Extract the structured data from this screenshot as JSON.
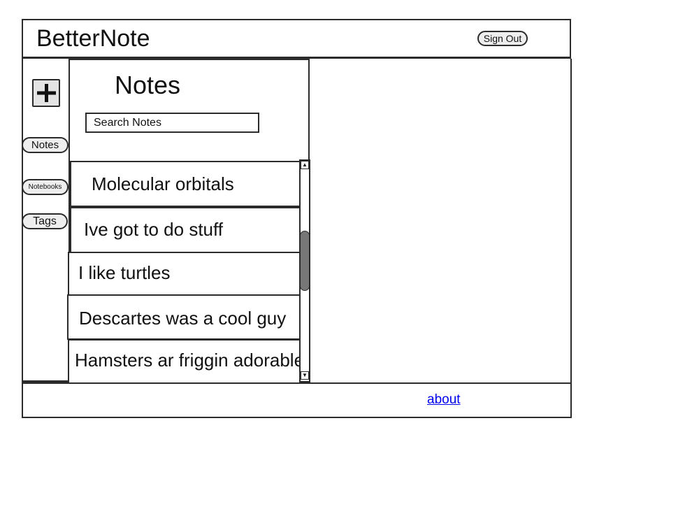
{
  "header": {
    "app_title": "BetterNote",
    "sign_out_label": "Sign Out"
  },
  "sidebar": {
    "add_icon": "plus-icon",
    "items": [
      {
        "label": "Notes"
      },
      {
        "label": "Notebooks"
      },
      {
        "label": "Tags"
      }
    ]
  },
  "notes_panel": {
    "heading": "Notes",
    "search_placeholder": "Search Notes",
    "notes": [
      {
        "title": "Molecular orbitals"
      },
      {
        "title": "Ive got to do stuff"
      },
      {
        "title": "I like turtles"
      },
      {
        "title": "Descartes was a cool guy"
      },
      {
        "title": "Hamsters ar friggin adorable"
      }
    ],
    "scroll_up_glyph": "▲",
    "scroll_down_glyph": "▼"
  },
  "footer": {
    "about_label": "about"
  },
  "colors": {
    "border": "#2b2b2b",
    "button_fill": "#eeeeee",
    "scroll_thumb": "#777777",
    "link": "#0000ee"
  }
}
